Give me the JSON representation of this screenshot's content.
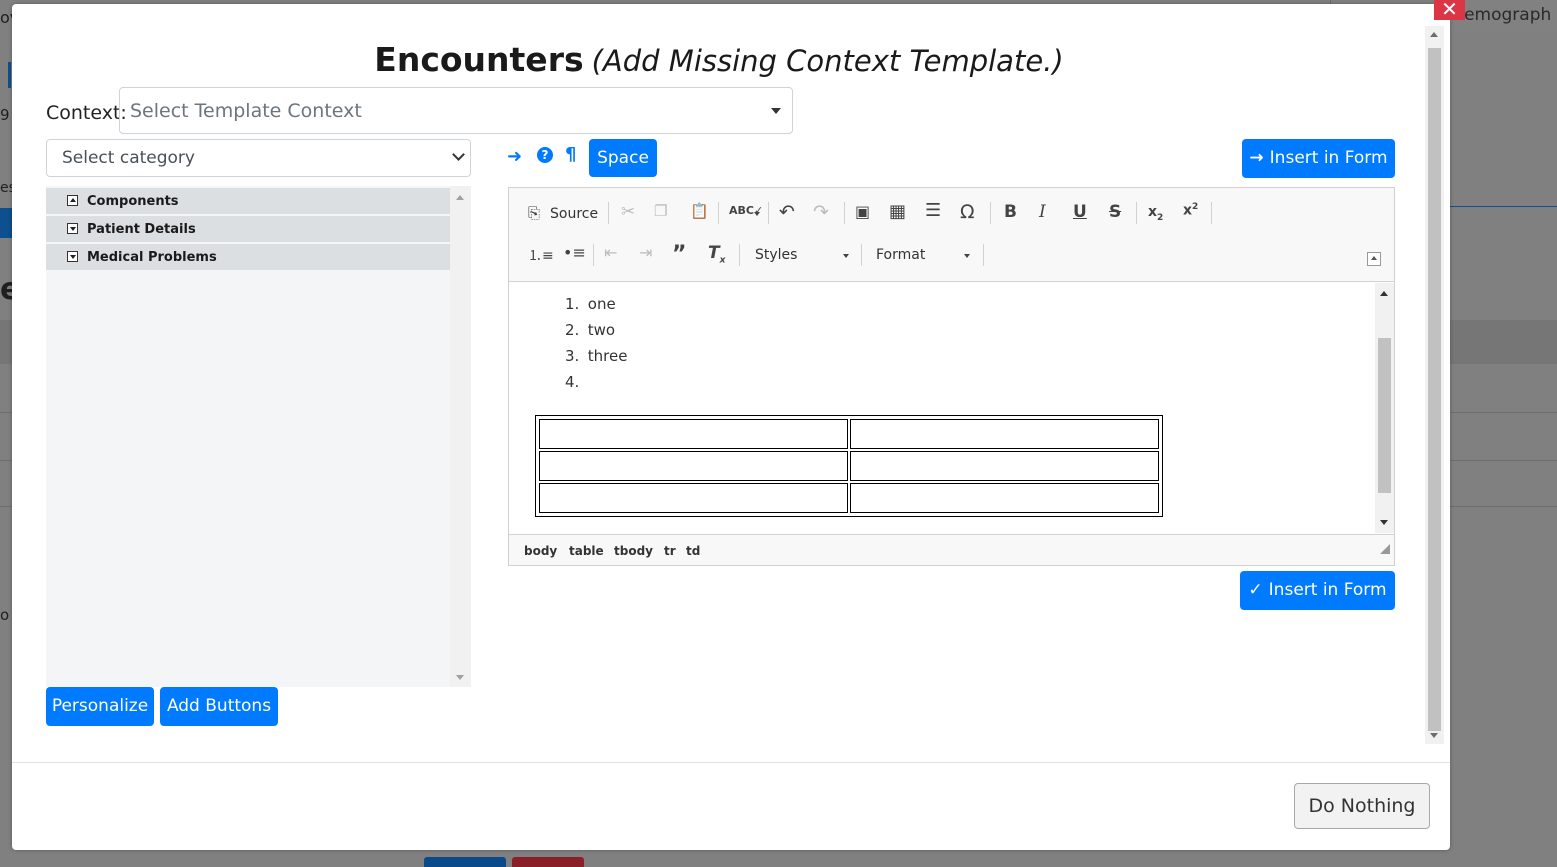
{
  "background": {
    "tab_label": "Demograph",
    "fragments": [
      "ov",
      "9",
      "es",
      "e",
      "o"
    ]
  },
  "modal": {
    "close_label": "✕",
    "title": "Encounters",
    "subtitle": "(Add Missing Context Template.)",
    "context_label": "Context:",
    "context_placeholder": "Select Template Context",
    "category_placeholder": "Select category",
    "tree": [
      {
        "label": "Components",
        "state": "expanded"
      },
      {
        "label": "Patient Details",
        "state": "collapsed"
      },
      {
        "label": "Medical Problems",
        "state": "collapsed"
      }
    ],
    "personalize_label": "Personalize",
    "add_buttons_label": "Add Buttons",
    "space_label": "Space",
    "insert_top_label": "Insert in Form",
    "insert_bottom_label": "Insert in Form",
    "do_nothing_label": "Do Nothing"
  },
  "editor": {
    "source_label": "Source",
    "styles_label": "Styles",
    "format_label": "Format",
    "list": [
      {
        "n": "1.",
        "text": "one"
      },
      {
        "n": "2.",
        "text": "two"
      },
      {
        "n": "3.",
        "text": "three"
      },
      {
        "n": "4.",
        "text": ""
      }
    ],
    "path": [
      "body",
      "table",
      "tbody",
      "tr",
      "td"
    ]
  },
  "colors": {
    "primary": "#007bff",
    "danger": "#dc3545",
    "overlay": "#808080"
  }
}
